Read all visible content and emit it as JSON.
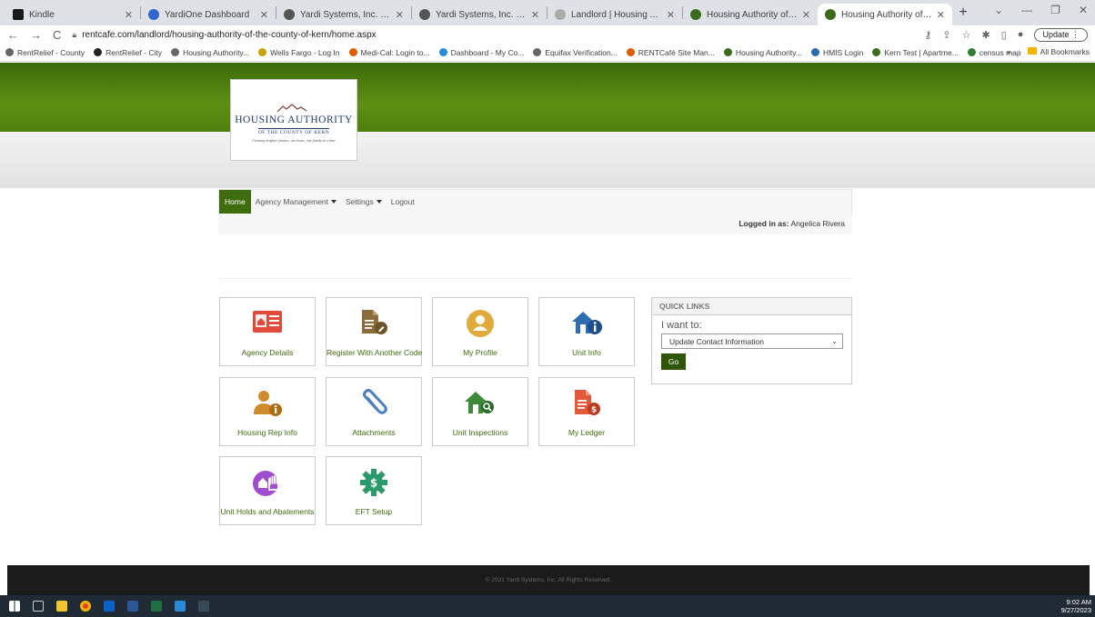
{
  "browser": {
    "tabs": [
      {
        "label": "Kindle",
        "color": "#1a1a1a"
      },
      {
        "label": "YardiOne Dashboard",
        "color": "#3366cc"
      },
      {
        "label": "Yardi Systems, Inc. - Inspection",
        "color": "#555555"
      },
      {
        "label": "Yardi Systems, Inc. - Inspection",
        "color": "#555555"
      },
      {
        "label": "Landlord | Housing Authority o",
        "color": "#aaaaaa"
      },
      {
        "label": "Housing Authority of the Count",
        "color": "#3a6b1a"
      },
      {
        "label": "Housing Authority of the Count",
        "color": "#3a6b1a",
        "active": true
      }
    ],
    "url": "rentcafe.com/landlord/housing-authority-of-the-county-of-kern/home.aspx",
    "update_label": "Update",
    "bookmarks": [
      {
        "label": "RentRelief - County",
        "color": "#666666"
      },
      {
        "label": "RentRelief - City",
        "color": "#222222"
      },
      {
        "label": "Housing Authority...",
        "color": "#666666"
      },
      {
        "label": "Wells Fargo - Log In",
        "color": "#c8a000"
      },
      {
        "label": "Medi-Cal: Login to...",
        "color": "#e05a00"
      },
      {
        "label": "Dashboard - My Co...",
        "color": "#2a8cd8"
      },
      {
        "label": "Equifax Verification...",
        "color": "#666666"
      },
      {
        "label": "RENTCafé Site Man...",
        "color": "#e05a00"
      },
      {
        "label": "Housing Authority...",
        "color": "#3a6b1a"
      },
      {
        "label": "HMIS Login",
        "color": "#2a6ab0"
      },
      {
        "label": "Kern Test | Apartme...",
        "color": "#3a6b1a"
      },
      {
        "label": "census map",
        "color": "#2f7d32"
      }
    ],
    "all_bookmarks_label": "All Bookmarks"
  },
  "logo": {
    "title": "HOUSING AUTHORITY",
    "subtitle": "OF THE COUNTY OF KERN",
    "tagline": "Creating brighter futures, one home, one family at a time"
  },
  "nav": {
    "home": "Home",
    "agency_management": "Agency Management",
    "settings": "Settings",
    "logout": "Logout"
  },
  "logged_in": {
    "prefix": "Logged in as:",
    "user": "Angelica Rivera"
  },
  "tiles": [
    {
      "label": "Agency Details",
      "icon": "agency-details-icon",
      "color": "#e24b3b"
    },
    {
      "label": "Register With Another Code",
      "icon": "register-icon",
      "color": "#8a6d3b"
    },
    {
      "label": "My Profile",
      "icon": "profile-icon",
      "color": "#e2a93b"
    },
    {
      "label": "Unit Info",
      "icon": "unit-info-icon",
      "color": "#2e6db4"
    },
    {
      "label": "Housing Rep Info",
      "icon": "housing-rep-icon",
      "color": "#d08a2e"
    },
    {
      "label": "Attachments",
      "icon": "paperclip-icon",
      "color": "#4a7fc1"
    },
    {
      "label": "Unit Inspections",
      "icon": "unit-inspection-icon",
      "color": "#3a8a3a"
    },
    {
      "label": "My Ledger",
      "icon": "ledger-icon",
      "color": "#e25a3b"
    },
    {
      "label": "Unit Holds and Abatements",
      "icon": "unit-holds-icon",
      "color": "#a04ed0"
    },
    {
      "label": "EFT Setup",
      "icon": "eft-gear-icon",
      "color": "#2a9a6a"
    }
  ],
  "quick_links": {
    "title": "QUICK LINKS",
    "prompt": "I want to:",
    "selected": "Update Contact Information",
    "go": "Go"
  },
  "footer": "© 2021 Yardi Systems, Inc. All Rights Reserved.",
  "taskbar": {
    "time": "9:02 AM",
    "date": "9/27/2023"
  }
}
